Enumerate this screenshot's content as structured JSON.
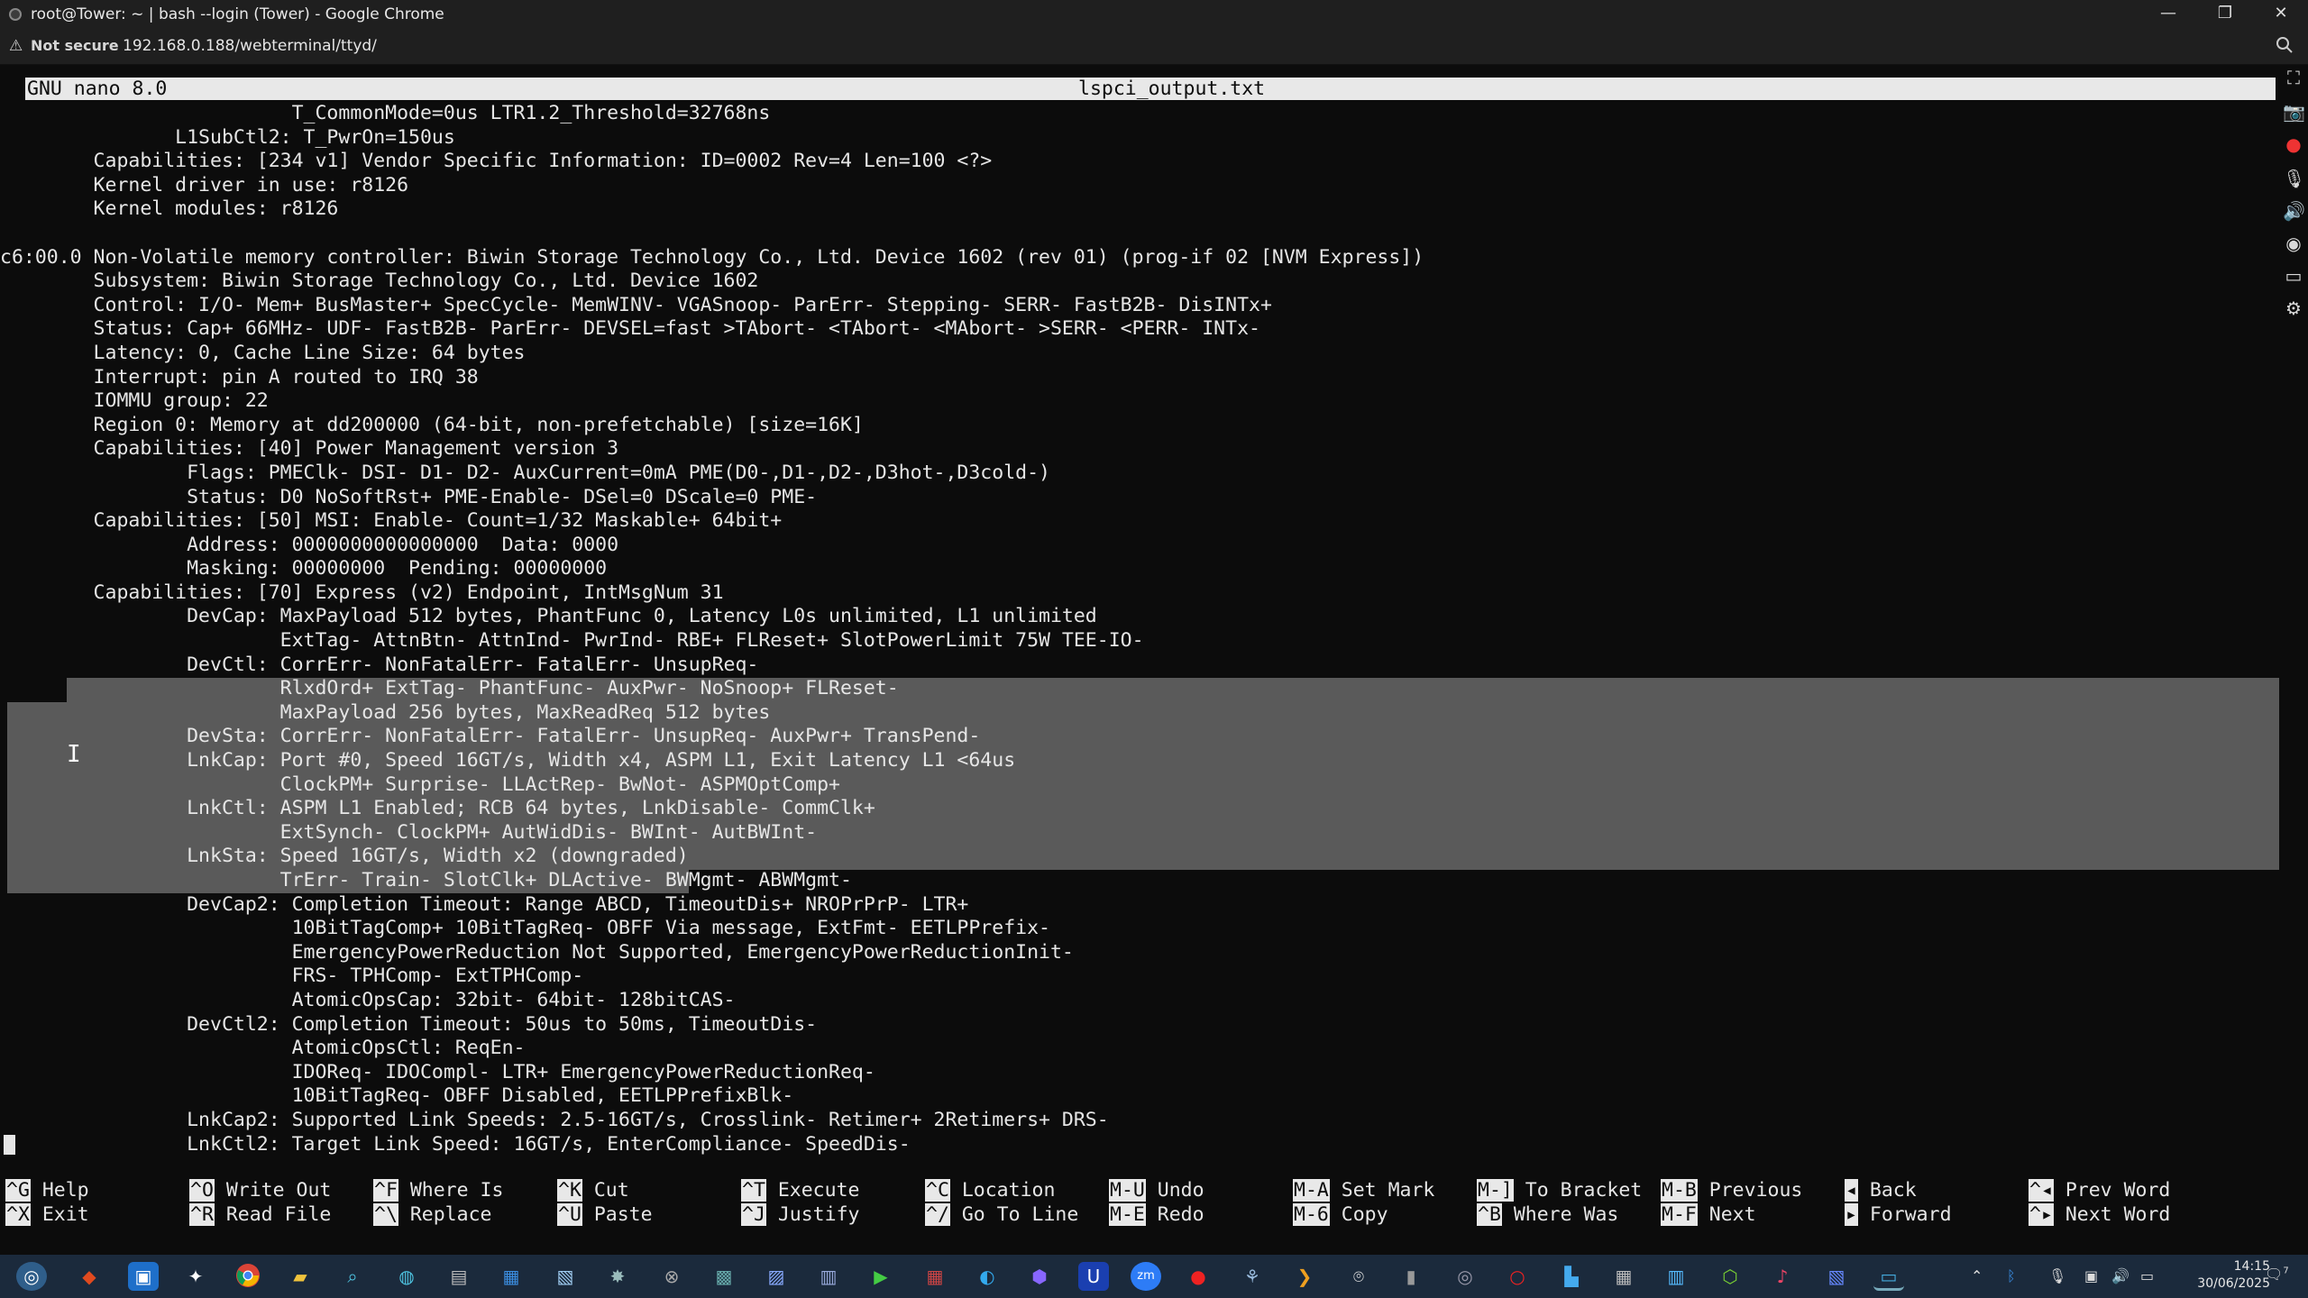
{
  "window": {
    "title": "root@Tower: ~ | bash --login (Tower) - Google Chrome",
    "address_warning": "Not secure",
    "url": "192.168.0.188/webterminal/ttyd/"
  },
  "nano": {
    "version": "GNU nano 8.0",
    "filename": "lspci_output.txt"
  },
  "lines": [
    "                         T_CommonMode=0us LTR1.2_Threshold=32768ns",
    "               L1SubCtl2: T_PwrOn=150us",
    "        Capabilities: [234 v1] Vendor Specific Information: ID=0002 Rev=4 Len=100 <?>",
    "        Kernel driver in use: r8126",
    "        Kernel modules: r8126",
    "",
    "c6:00.0 Non-Volatile memory controller: Biwin Storage Technology Co., Ltd. Device 1602 (rev 01) (prog-if 02 [NVM Express])",
    "        Subsystem: Biwin Storage Technology Co., Ltd. Device 1602",
    "        Control: I/O- Mem+ BusMaster+ SpecCycle- MemWINV- VGASnoop- ParErr- Stepping- SERR- FastB2B- DisINTx+",
    "        Status: Cap+ 66MHz- UDF- FastB2B- ParErr- DEVSEL=fast >TAbort- <TAbort- <MAbort- >SERR- <PERR- INTx-",
    "        Latency: 0, Cache Line Size: 64 bytes",
    "        Interrupt: pin A routed to IRQ 38",
    "        IOMMU group: 22",
    "        Region 0: Memory at dd200000 (64-bit, non-prefetchable) [size=16K]",
    "        Capabilities: [40] Power Management version 3",
    "                Flags: PMEClk- DSI- D1- D2- AuxCurrent=0mA PME(D0-,D1-,D2-,D3hot-,D3cold-)",
    "                Status: D0 NoSoftRst+ PME-Enable- DSel=0 DScale=0 PME-",
    "        Capabilities: [50] MSI: Enable- Count=1/32 Maskable+ 64bit+",
    "                Address: 0000000000000000  Data: 0000",
    "                Masking: 00000000  Pending: 00000000",
    "        Capabilities: [70] Express (v2) Endpoint, IntMsgNum 31",
    "                DevCap: MaxPayload 512 bytes, PhantFunc 0, Latency L0s unlimited, L1 unlimited",
    "                        ExtTag- AttnBtn- AttnInd- PwrInd- RBE+ FLReset+ SlotPowerLimit 75W TEE-IO-",
    "                DevCtl: CorrErr- NonFatalErr- FatalErr- UnsupReq-",
    "                        RlxdOrd+ ExtTag- PhantFunc- AuxPwr- NoSnoop+ FLReset-",
    "                        MaxPayload 256 bytes, MaxReadReq 512 bytes",
    "                DevSta: CorrErr- NonFatalErr- FatalErr- UnsupReq- AuxPwr+ TransPend-",
    "                LnkCap: Port #0, Speed 16GT/s, Width x4, ASPM L1, Exit Latency L1 <64us",
    "                        ClockPM+ Surprise- LLActRep- BwNot- ASPMOptComp+",
    "                LnkCtl: ASPM L1 Enabled; RCB 64 bytes, LnkDisable- CommClk+",
    "                        ExtSynch- ClockPM+ AutWidDis- BWInt- AutBWInt-",
    "                LnkSta: Speed 16GT/s, Width x2 (downgraded)",
    "                        TrErr- Train- SlotClk+ DLActive- BWMgmt- ABWMgmt-",
    "                DevCap2: Completion Timeout: Range ABCD, TimeoutDis+ NROPrPrP- LTR+",
    "                         10BitTagComp+ 10BitTagReq- OBFF Via message, ExtFmt- EETLPPrefix-",
    "                         EmergencyPowerReduction Not Supported, EmergencyPowerReductionInit-",
    "                         FRS- TPHComp- ExtTPHComp-",
    "                         AtomicOpsCap: 32bit- 64bit- 128bitCAS-",
    "                DevCtl2: Completion Timeout: 50us to 50ms, TimeoutDis-",
    "                         AtomicOpsCtl: ReqEn-",
    "                         IDOReq- IDOCompl- LTR+ EmergencyPowerReductionReq-",
    "                         10BitTagReq- OBFF Disabled, EETLPPrefixBlk-",
    "                LnkCap2: Supported Link Speeds: 2.5-16GT/s, Crosslink- Retimer+ 2Retimers+ DRS-",
    "                LnkCtl2: Target Link Speed: 16GT/s, EnterCompliance- SpeedDis-"
  ],
  "shortcuts": [
    {
      "key": "^G",
      "label": "Help"
    },
    {
      "key": "^X",
      "label": "Exit"
    },
    {
      "key": "^O",
      "label": "Write Out"
    },
    {
      "key": "^R",
      "label": "Read File"
    },
    {
      "key": "^F",
      "label": "Where Is"
    },
    {
      "key": "^\\",
      "label": "Replace"
    },
    {
      "key": "^K",
      "label": "Cut"
    },
    {
      "key": "^U",
      "label": "Paste"
    },
    {
      "key": "^T",
      "label": "Execute"
    },
    {
      "key": "^J",
      "label": "Justify"
    },
    {
      "key": "^C",
      "label": "Location"
    },
    {
      "key": "^/",
      "label": "Go To Line"
    },
    {
      "key": "M-U",
      "label": "Undo"
    },
    {
      "key": "M-E",
      "label": "Redo"
    },
    {
      "key": "M-A",
      "label": "Set Mark"
    },
    {
      "key": "M-6",
      "label": "Copy"
    },
    {
      "key": "M-]",
      "label": "To Bracket"
    },
    {
      "key": "^B",
      "label": "Where Was"
    },
    {
      "key": "M-B",
      "label": "Previous"
    },
    {
      "key": "M-F",
      "label": "Next"
    },
    {
      "key": "◂",
      "label": "Back"
    },
    {
      "key": "▸",
      "label": "Forward"
    },
    {
      "key": "^◂",
      "label": "Prev Word"
    },
    {
      "key": "^▸",
      "label": "Next Word"
    }
  ],
  "taskbar": {
    "time": "14:15",
    "date": "30/06/2025",
    "notification_count": "7"
  },
  "colors": {
    "terminal_bg": "#0c0c0c",
    "terminal_fg": "#e6e6e6",
    "selection": "#5a5a5a",
    "inverse_bar": "#e8e8e8",
    "taskbar": "#1b2a3c"
  }
}
